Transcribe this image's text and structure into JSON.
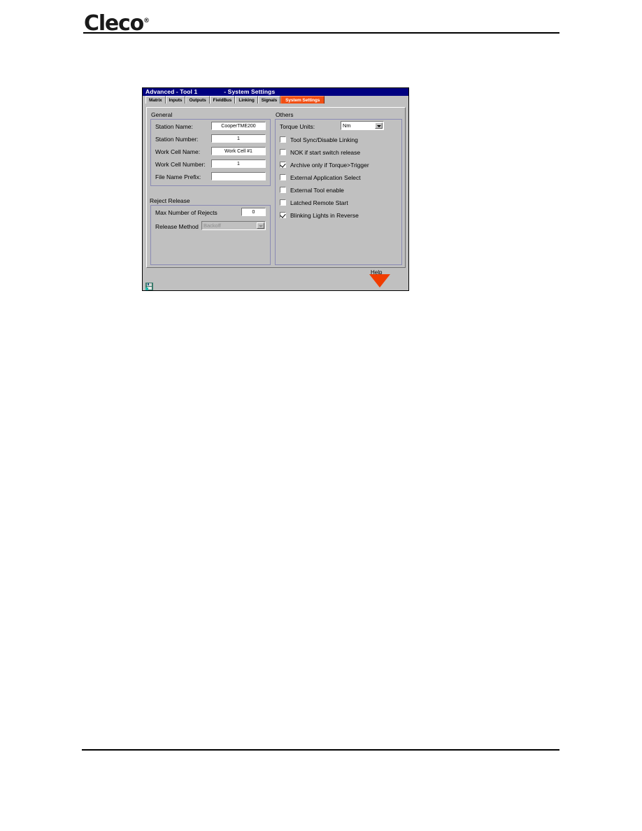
{
  "page": {
    "brand": "Cleco",
    "brand_mark": "®"
  },
  "dialog": {
    "title_left": "Advanced - Tool 1",
    "title_right": "- System Settings",
    "tabs": [
      {
        "label": "Matrix",
        "active": false
      },
      {
        "label": "Inputs",
        "active": false
      },
      {
        "label": "Outputs",
        "active": false
      },
      {
        "label": "FieldBus",
        "active": false
      },
      {
        "label": "Linking",
        "active": false
      },
      {
        "label": "Signals",
        "active": false
      },
      {
        "label": "System Settings",
        "active": true
      }
    ],
    "general": {
      "title": "General",
      "fields": [
        {
          "label": "Station Name:",
          "value": "CooperTME200"
        },
        {
          "label": "Station Number:",
          "value": "1"
        },
        {
          "label": "Work Cell Name:",
          "value": "Work Cell #1"
        },
        {
          "label": "Work Cell Number:",
          "value": "1"
        },
        {
          "label": "File Name Prefix:",
          "value": ""
        }
      ]
    },
    "reject_release": {
      "title": "Reject Release",
      "max_rejects_label": "Max Number of Rejects",
      "max_rejects_value": "0",
      "release_method_label": "Release Method",
      "release_method_value": "Backoff",
      "release_method_disabled": true
    },
    "others": {
      "title": "Others",
      "torque_units_label": "Torque Units:",
      "torque_units_value": "Nm",
      "checkboxes": [
        {
          "label": "Tool Sync/Disable Linking",
          "checked": false
        },
        {
          "label": "NOK if start switch release",
          "checked": false
        },
        {
          "label": "Archive only if Torque>Trigger",
          "checked": true
        },
        {
          "label": "External Application Select",
          "checked": false
        },
        {
          "label": "External Tool enable",
          "checked": false
        },
        {
          "label": "Latched Remote Start",
          "checked": false
        },
        {
          "label": "Blinking Lights in Reverse",
          "checked": true
        }
      ]
    },
    "help_label": "Help",
    "status_icon": "save-disk-icon"
  },
  "colors": {
    "titlebar": "#000080",
    "active_tab": "#f24f13",
    "dialog_face": "#c0c0c0",
    "group_border": "#8a8ab4",
    "help_triangle": "#f03c00"
  }
}
